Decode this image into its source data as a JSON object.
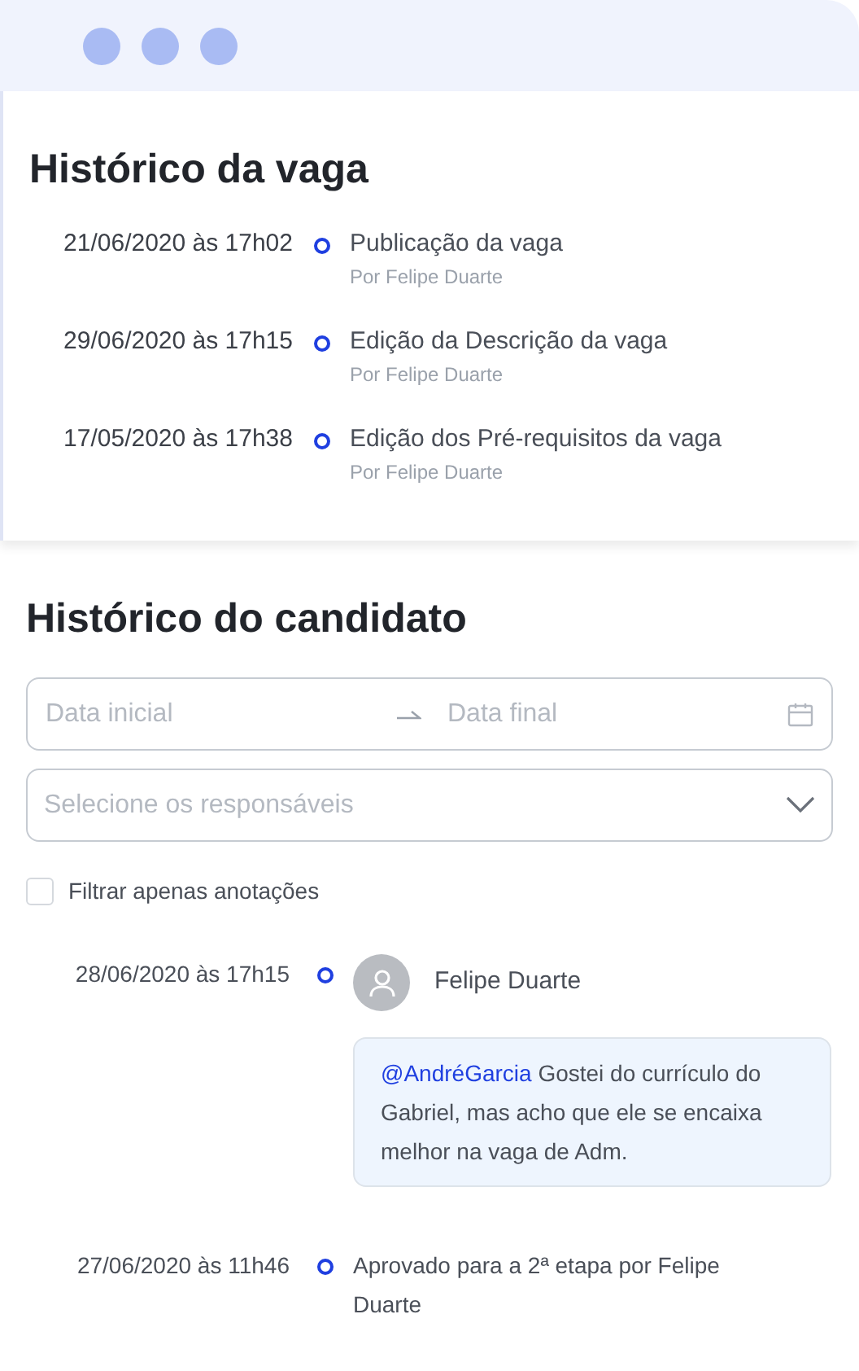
{
  "job_history": {
    "title": "Histórico da vaga",
    "entries": [
      {
        "date": "21/06/2020 às 17h02",
        "action": "Publicação da vaga",
        "author": "Por Felipe Duarte"
      },
      {
        "date": "29/06/2020 às 17h15",
        "action": "Edição da Descrição da vaga",
        "author": "Por Felipe Duarte"
      },
      {
        "date": "17/05/2020 às 17h38",
        "action": "Edição dos Pré-requisitos da vaga",
        "author": "Por Felipe Duarte"
      }
    ]
  },
  "candidate_history": {
    "title": "Histórico do candidato",
    "date_range": {
      "start_placeholder": "Data inicial",
      "end_placeholder": "Data final"
    },
    "responsible_select": {
      "placeholder": "Selecione os responsáveis"
    },
    "notes_filter": {
      "label": "Filtrar apenas anotações",
      "checked": false
    },
    "entries": [
      {
        "kind": "note",
        "date": "28/06/2020 às 17h15",
        "author": "Felipe Duarte",
        "mention": "@AndréGarcia",
        "text": "Gostei do currículo do Gabriel, mas acho que ele se encaixa melhor na vaga de Adm."
      },
      {
        "kind": "event",
        "date": "27/06/2020 às 11h46",
        "text": "Aprovado para a 2ª etapa por Felipe Duarte"
      }
    ]
  }
}
